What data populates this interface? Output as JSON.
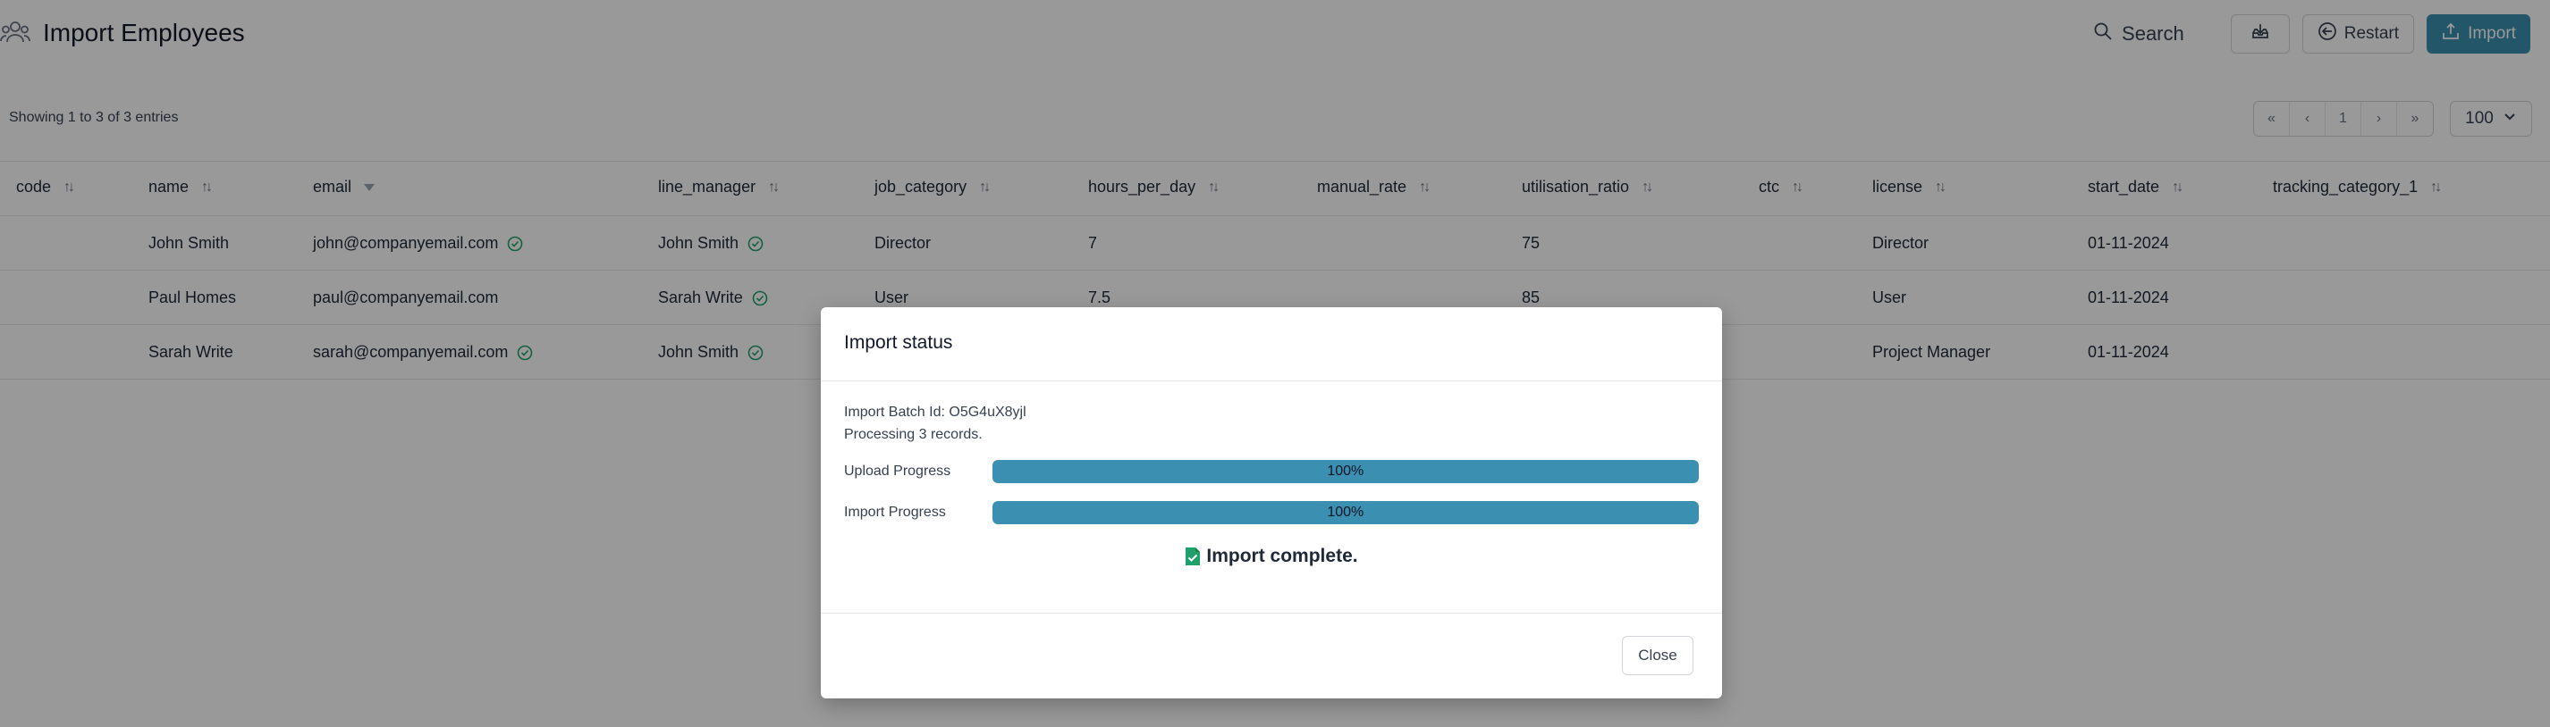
{
  "header": {
    "title": "Import Employees",
    "search_label": "Search",
    "restart_label": "Restart",
    "import_label": "Import"
  },
  "entries_text": "Showing 1 to 3 of 3 entries",
  "pagination": {
    "first": "«",
    "prev": "‹",
    "current_page": "1",
    "next": "›",
    "last": "»",
    "page_size": "100"
  },
  "table": {
    "columns": [
      "code",
      "name",
      "email",
      "line_manager",
      "job_category",
      "hours_per_day",
      "manual_rate",
      "utilisation_ratio",
      "ctc",
      "license",
      "start_date",
      "tracking_category_1"
    ],
    "rows": [
      {
        "code": "",
        "name": "John Smith",
        "email": "john@companyemail.com",
        "line_manager": "John Smith",
        "job_category": "Director",
        "hours_per_day": "7",
        "manual_rate": "",
        "utilisation_ratio": "75",
        "ctc": "",
        "license": "Director",
        "start_date": "01-11-2024",
        "tracking_category_1": ""
      },
      {
        "code": "",
        "name": "Paul Homes",
        "email": "paul@companyemail.com",
        "line_manager": "Sarah Write",
        "job_category": "User",
        "hours_per_day": "7.5",
        "manual_rate": "",
        "utilisation_ratio": "85",
        "ctc": "",
        "license": "User",
        "start_date": "01-11-2024",
        "tracking_category_1": ""
      },
      {
        "code": "",
        "name": "Sarah Write",
        "email": "sarah@companyemail.com",
        "line_manager": "John Smith",
        "job_category": "",
        "hours_per_day": "",
        "manual_rate": "",
        "utilisation_ratio": "",
        "ctc": "",
        "license": "Project Manager",
        "start_date": "01-11-2024",
        "tracking_category_1": ""
      }
    ]
  },
  "modal": {
    "title": "Import status",
    "batch_text": "Import Batch Id: O5G4uX8yjl",
    "processing_text": "Processing 3 records.",
    "upload_label": "Upload Progress",
    "upload_percent": 100,
    "upload_text": "100%",
    "import_label": "Import Progress",
    "import_percent": 100,
    "import_text": "100%",
    "complete_text": "Import complete.",
    "close_label": "Close"
  },
  "colors": {
    "accent": "#3b8fb0",
    "success": "#22a06b",
    "overlay": "rgba(0,0,0,0.40)"
  },
  "icons": {
    "title": "users-icon",
    "search": "search-icon",
    "download": "download-tray-icon",
    "restart": "arrow-left-circle-icon",
    "import": "upload-icon",
    "verified": "check-circle-icon",
    "complete": "document-check-icon"
  }
}
